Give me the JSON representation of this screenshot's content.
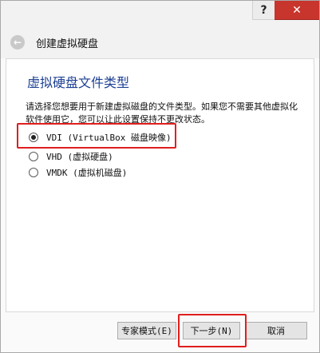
{
  "titlebar": {
    "help_label": "?",
    "close_label": "✕"
  },
  "wizard": {
    "back_label": "←",
    "title": "创建虚拟硬盘"
  },
  "page": {
    "heading": "虚拟硬盘文件类型",
    "description": "请选择您想要用于新建虚拟磁盘的文件类型。如果您不需要其他虚拟化软件使用它，您可以让此设置保持不更改状态。"
  },
  "options": [
    {
      "label": "VDI (VirtualBox 磁盘映像)",
      "checked": true
    },
    {
      "label": "VHD (虚拟硬盘)",
      "checked": false
    },
    {
      "label": "VMDK (虚拟机磁盘)",
      "checked": false
    }
  ],
  "buttons": {
    "expert": "专家模式(E)",
    "next": "下一步(N)",
    "cancel": "取消"
  },
  "colors": {
    "highlight": "#e01e1e",
    "heading": "#1c3f94",
    "close": "#c7352d"
  }
}
